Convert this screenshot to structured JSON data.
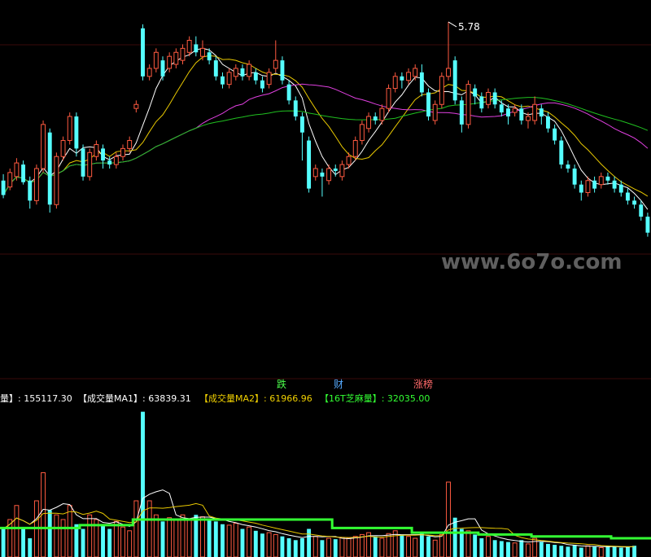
{
  "watermark": "www.6o7o.com",
  "price_panel": {
    "peak_label": "5.78"
  },
  "tabs": [
    {
      "label": "跌",
      "color": "#4cff4c"
    },
    {
      "label": "财",
      "color": "#55aaff"
    },
    {
      "label": "涨榜",
      "color": "#ff6a6a"
    }
  ],
  "volume_legend": {
    "items": [
      {
        "text": "量】: 155117.30",
        "color": "#ffffff"
      },
      {
        "text": "【成交量MA1】: 63839.31",
        "color": "#ffffff"
      },
      {
        "text": "【成交量MA2】: 61966.96",
        "color": "#f0d000"
      },
      {
        "text": "【16T芝麻量】: 32035.00",
        "color": "#33ff33"
      }
    ]
  },
  "colors": {
    "up": "#ff5a40",
    "down": "#55ffff",
    "ma_white": "#ffffff",
    "ma_yellow": "#e8c800",
    "ma_magenta": "#e040e0",
    "ma_green": "#20c020",
    "sesame": "#33ff33",
    "background": "#000000"
  },
  "chart_data": [
    {
      "type": "candlestick",
      "annotations": [
        "5.78"
      ],
      "ylim": [
        2.7,
        5.85
      ],
      "candles": [
        [
          3.8,
          3.62,
          3.88,
          3.58
        ],
        [
          3.72,
          3.9,
          3.95,
          3.68
        ],
        [
          3.85,
          4.02,
          4.08,
          3.8
        ],
        [
          4.0,
          3.78,
          4.05,
          3.75
        ],
        [
          3.8,
          3.55,
          3.85,
          3.45
        ],
        [
          3.55,
          3.95,
          4.0,
          3.5
        ],
        [
          3.95,
          4.5,
          4.55,
          3.9
        ],
        [
          4.4,
          3.5,
          4.45,
          3.4
        ],
        [
          3.5,
          4.1,
          4.15,
          3.45
        ],
        [
          4.1,
          4.3,
          4.35,
          4.05
        ],
        [
          4.3,
          4.6,
          4.65,
          4.25
        ],
        [
          4.6,
          4.2,
          4.65,
          4.1
        ],
        [
          4.2,
          3.85,
          4.25,
          3.8
        ],
        [
          3.85,
          4.15,
          4.2,
          3.8
        ],
        [
          4.1,
          4.25,
          4.3,
          4.05
        ],
        [
          4.2,
          4.05,
          4.25,
          3.95
        ],
        [
          4.05,
          4.0,
          4.1,
          3.95
        ],
        [
          4.0,
          4.1,
          4.15,
          3.95
        ],
        [
          4.1,
          4.2,
          4.25,
          4.05
        ],
        [
          4.2,
          4.3,
          4.35,
          4.15
        ],
        [
          4.7,
          4.75,
          4.8,
          4.65
        ],
        [
          5.7,
          5.1,
          5.75,
          5.05
        ],
        [
          5.1,
          5.2,
          5.25,
          5.05
        ],
        [
          5.2,
          5.4,
          5.45,
          5.15
        ],
        [
          5.3,
          5.1,
          5.35,
          5.05
        ],
        [
          5.2,
          5.35,
          5.4,
          5.15
        ],
        [
          5.25,
          5.4,
          5.45,
          5.2
        ],
        [
          5.3,
          5.45,
          5.5,
          5.25
        ],
        [
          5.4,
          5.55,
          5.6,
          5.35
        ],
        [
          5.5,
          5.4,
          5.6,
          5.35
        ],
        [
          5.35,
          5.45,
          5.55,
          5.3
        ],
        [
          5.4,
          5.3,
          5.45,
          5.25
        ],
        [
          5.3,
          5.1,
          5.35,
          5.05
        ],
        [
          5.1,
          5.0,
          5.15,
          4.95
        ],
        [
          5.0,
          5.15,
          5.2,
          4.95
        ],
        [
          5.1,
          5.2,
          5.25,
          5.05
        ],
        [
          5.2,
          5.1,
          5.25,
          5.05
        ],
        [
          5.1,
          5.25,
          5.3,
          5.05
        ],
        [
          5.15,
          5.05,
          5.2,
          5.0
        ],
        [
          5.05,
          4.95,
          5.1,
          4.9
        ],
        [
          5.0,
          5.15,
          5.2,
          4.95
        ],
        [
          5.2,
          5.3,
          5.55,
          5.15
        ],
        [
          5.3,
          5.05,
          5.35,
          5.0
        ],
        [
          5.0,
          4.8,
          5.05,
          4.75
        ],
        [
          4.8,
          4.6,
          4.85,
          4.55
        ],
        [
          4.6,
          4.4,
          4.65,
          4.05
        ],
        [
          4.3,
          3.7,
          4.35,
          3.65
        ],
        [
          3.85,
          3.95,
          4.0,
          3.8
        ],
        [
          3.9,
          3.85,
          3.95,
          3.6
        ],
        [
          3.8,
          3.95,
          4.0,
          3.75
        ],
        [
          3.95,
          3.92,
          4.0,
          3.85
        ],
        [
          3.85,
          4.0,
          4.05,
          3.8
        ],
        [
          4.0,
          4.1,
          4.15,
          3.95
        ],
        [
          4.1,
          4.3,
          4.35,
          4.05
        ],
        [
          4.3,
          4.5,
          4.55,
          4.25
        ],
        [
          4.45,
          4.6,
          4.65,
          4.4
        ],
        [
          4.6,
          4.55,
          4.65,
          4.5
        ],
        [
          4.55,
          4.7,
          4.75,
          4.5
        ],
        [
          4.7,
          4.95,
          5.0,
          4.65
        ],
        [
          4.95,
          5.1,
          5.15,
          4.9
        ],
        [
          5.1,
          5.05,
          5.15,
          4.95
        ],
        [
          5.05,
          5.15,
          5.2,
          5.0
        ],
        [
          5.1,
          5.2,
          5.25,
          5.05
        ],
        [
          5.15,
          4.9,
          5.25,
          4.85
        ],
        [
          4.9,
          4.6,
          4.95,
          4.55
        ],
        [
          4.55,
          4.75,
          4.8,
          4.5
        ],
        [
          4.75,
          5.1,
          5.15,
          4.7
        ],
        [
          5.1,
          5.2,
          5.78,
          5.05
        ],
        [
          5.3,
          4.8,
          5.35,
          4.75
        ],
        [
          4.8,
          4.5,
          4.85,
          4.4
        ],
        [
          4.5,
          5.0,
          5.05,
          4.45
        ],
        [
          4.95,
          4.85,
          5.0,
          4.75
        ],
        [
          4.85,
          4.7,
          4.9,
          4.65
        ],
        [
          4.75,
          4.9,
          4.95,
          4.7
        ],
        [
          4.9,
          4.75,
          4.95,
          4.7
        ],
        [
          4.75,
          4.65,
          4.8,
          4.6
        ],
        [
          4.7,
          4.6,
          4.75,
          4.5
        ],
        [
          4.65,
          4.7,
          4.75,
          4.6
        ],
        [
          4.7,
          4.55,
          4.75,
          4.5
        ],
        [
          4.55,
          4.6,
          4.65,
          4.45
        ],
        [
          4.55,
          4.75,
          4.85,
          4.5
        ],
        [
          4.7,
          4.6,
          4.75,
          4.5
        ],
        [
          4.6,
          4.45,
          4.65,
          4.4
        ],
        [
          4.45,
          4.3,
          4.5,
          4.25
        ],
        [
          4.3,
          4.0,
          4.35,
          3.95
        ],
        [
          4.0,
          3.95,
          4.05,
          3.9
        ],
        [
          3.95,
          3.75,
          4.0,
          3.7
        ],
        [
          3.75,
          3.65,
          3.8,
          3.55
        ],
        [
          3.65,
          3.8,
          3.85,
          3.6
        ],
        [
          3.8,
          3.7,
          3.85,
          3.65
        ],
        [
          3.75,
          3.85,
          3.9,
          3.7
        ],
        [
          3.85,
          3.8,
          3.9,
          3.75
        ],
        [
          3.8,
          3.7,
          3.85,
          3.65
        ],
        [
          3.75,
          3.65,
          3.8,
          3.6
        ],
        [
          3.65,
          3.55,
          3.7,
          3.5
        ],
        [
          3.55,
          3.5,
          3.6,
          3.45
        ],
        [
          3.5,
          3.35,
          3.55,
          3.3
        ],
        [
          3.35,
          3.15,
          3.4,
          3.1
        ]
      ]
    },
    {
      "type": "bar",
      "ylim": [
        0,
        160000
      ],
      "volumes": [
        30000,
        40000,
        55000,
        30000,
        20000,
        60000,
        90000,
        50000,
        45000,
        40000,
        55000,
        35000,
        30000,
        45000,
        40000,
        35000,
        30000,
        38000,
        32000,
        28000,
        60000,
        155117,
        60000,
        45000,
        38000,
        42000,
        40000,
        45000,
        40000,
        45000,
        43000,
        40000,
        38000,
        35000,
        34000,
        36000,
        30000,
        32000,
        28000,
        25000,
        26000,
        24000,
        22000,
        20000,
        18000,
        20000,
        30000,
        22000,
        18000,
        20000,
        19000,
        21000,
        20000,
        22000,
        24000,
        26000,
        22000,
        20000,
        25000,
        28000,
        24000,
        22000,
        20000,
        26000,
        22000,
        18000,
        24000,
        80000,
        42000,
        30000,
        28000,
        24000,
        20000,
        22000,
        18000,
        17000,
        16000,
        15000,
        18000,
        14000,
        20000,
        16000,
        14000,
        13000,
        12000,
        11000,
        13000,
        10000,
        12000,
        11000,
        10000,
        12000,
        11000,
        10000,
        10500,
        12000
      ],
      "sesame_level_steps": [
        [
          0,
          31000
        ],
        [
          12,
          34000
        ],
        [
          20,
          40000
        ],
        [
          50,
          31000
        ],
        [
          62,
          26000
        ],
        [
          72,
          24000
        ],
        [
          80,
          22000
        ],
        [
          92,
          20000
        ]
      ]
    }
  ]
}
